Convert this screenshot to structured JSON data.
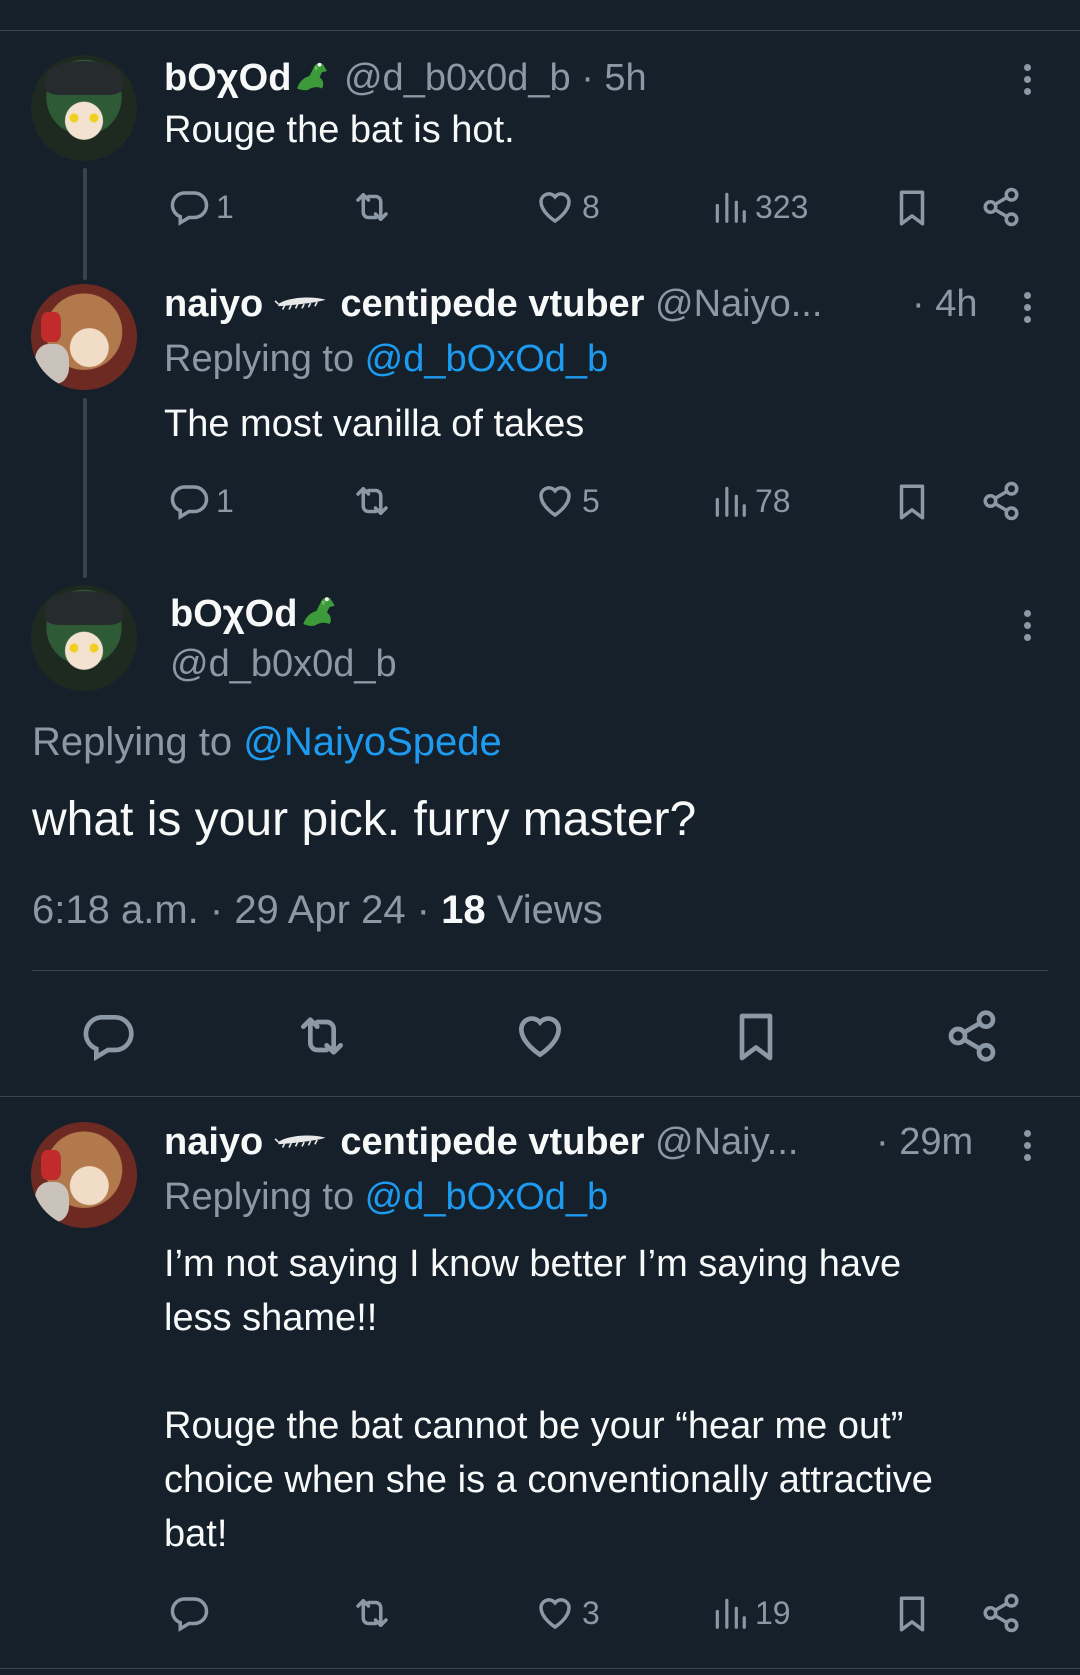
{
  "tweet1": {
    "display_name": "bOχOd",
    "handle": "@d_b0x0d_b",
    "time": "· 5h",
    "text": "Rouge the bat is hot.",
    "replies": "1",
    "retweets": "",
    "likes": "8",
    "views": "323"
  },
  "tweet2": {
    "display_name": "naiyo",
    "display_name_suffix": "centipede vtuber",
    "handle": "@Naiyo...",
    "time": "· 4h",
    "replying_prefix": "Replying to ",
    "replying_to": "@d_bOxOd_b",
    "text": "The most vanilla of takes",
    "replies": "1",
    "likes": "5",
    "views": "78"
  },
  "main": {
    "display_name": "bOχOd",
    "handle": "@d_b0x0d_b",
    "replying_prefix": "Replying to ",
    "replying_to": "@NaiyoSpede",
    "text": "what is your pick. furry master?",
    "time": "6:18 a.m.",
    "date": "29 Apr 24",
    "views_count": "18",
    "views_label": "Views"
  },
  "tweet3": {
    "display_name": "naiyo",
    "display_name_suffix": "centipede vtuber",
    "handle": "@Naiy...",
    "time": "· 29m",
    "replying_prefix": "Replying to ",
    "replying_to": "@d_bOxOd_b",
    "text": "I’m not saying I know better I’m saying have\nless shame!!\n\nRouge the bat cannot be your “hear me out”\nchoice when she is a conventionally attractive\nbat!",
    "replies": "",
    "likes": "3",
    "views": "19"
  },
  "icons": [
    "more-icon",
    "reply-icon",
    "retweet-icon",
    "like-icon",
    "views-icon",
    "bookmark-icon",
    "share-icon",
    "alligator-emoji-icon",
    "centipede-emoji-icon"
  ],
  "colors": {
    "background": "#15202b",
    "text": "#f7f9f9",
    "secondary": "#8b98a5",
    "link": "#1d9bf0",
    "divider": "#38444d"
  }
}
